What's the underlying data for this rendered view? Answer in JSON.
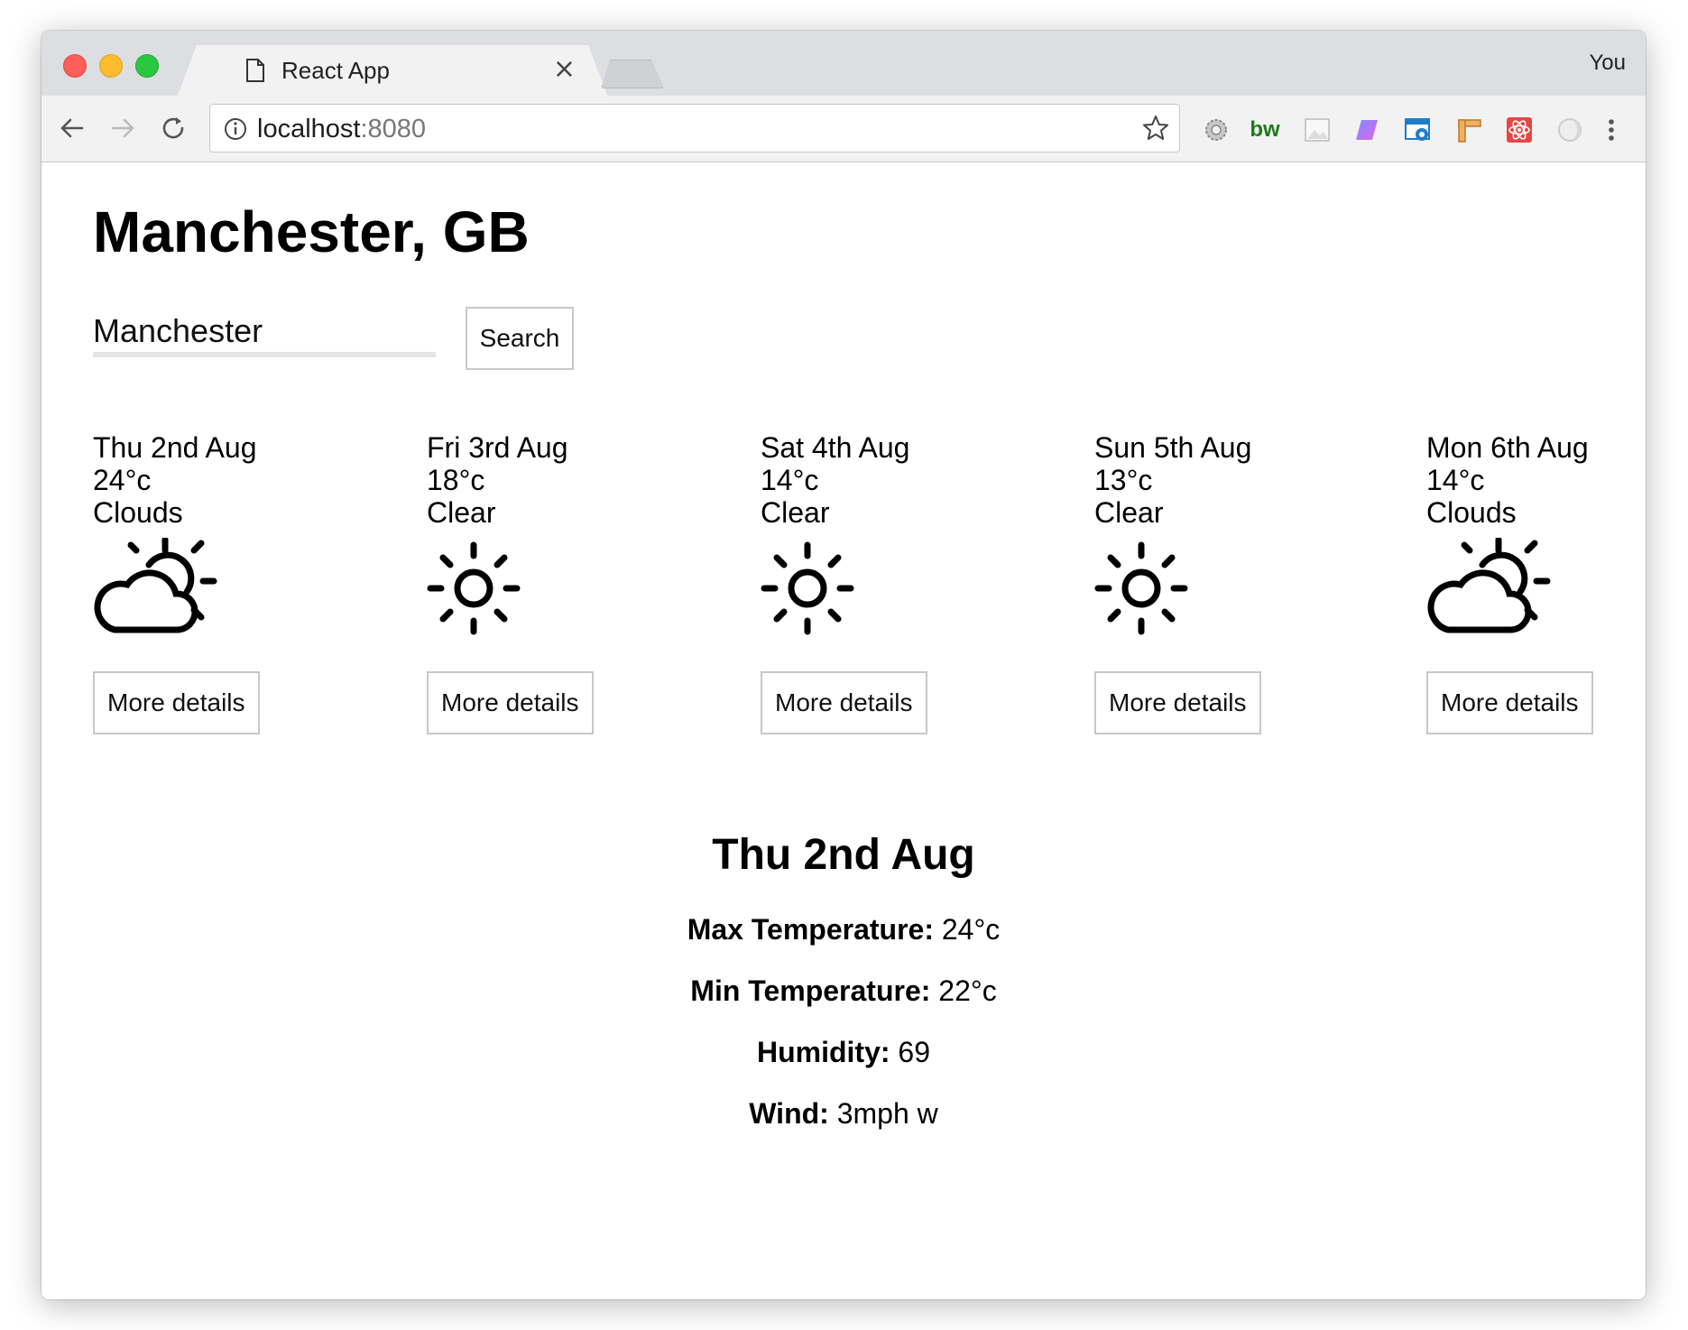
{
  "browser": {
    "tab_title": "React App",
    "tab_close": "×",
    "profile": "You",
    "url_host": "localhost",
    "url_port": ":8080",
    "extensions": [
      "gear-extension",
      "bw-extension",
      "image-extension",
      "gradient-extension",
      "screenshot-extension",
      "ruler-extension",
      "react-extension",
      "circle-extension"
    ],
    "bw_label": "bw"
  },
  "app": {
    "city": "Manchester, GB",
    "search_value": "Manchester",
    "search_button": "Search",
    "forecast": [
      {
        "date": "Thu 2nd Aug",
        "temp": "24°c",
        "condition": "Clouds",
        "icon": "partly-cloudy-icon",
        "button": "More details"
      },
      {
        "date": "Fri 3rd Aug",
        "temp": "18°c",
        "condition": "Clear",
        "icon": "sun-icon",
        "button": "More details"
      },
      {
        "date": "Sat 4th Aug",
        "temp": "14°c",
        "condition": "Clear",
        "icon": "sun-icon",
        "button": "More details"
      },
      {
        "date": "Sun 5th Aug",
        "temp": "13°c",
        "condition": "Clear",
        "icon": "sun-icon",
        "button": "More details"
      },
      {
        "date": "Mon 6th Aug",
        "temp": "14°c",
        "condition": "Clouds",
        "icon": "partly-cloudy-icon",
        "button": "More details"
      }
    ],
    "selected": {
      "title": "Thu 2nd Aug",
      "max_label": "Max Temperature:",
      "max_value": " 24°c",
      "min_label": "Min Temperature:",
      "min_value": " 22°c",
      "humidity_label": "Humidity:",
      "humidity_value": " 69",
      "wind_label": "Wind:",
      "wind_value": " 3mph w"
    }
  }
}
